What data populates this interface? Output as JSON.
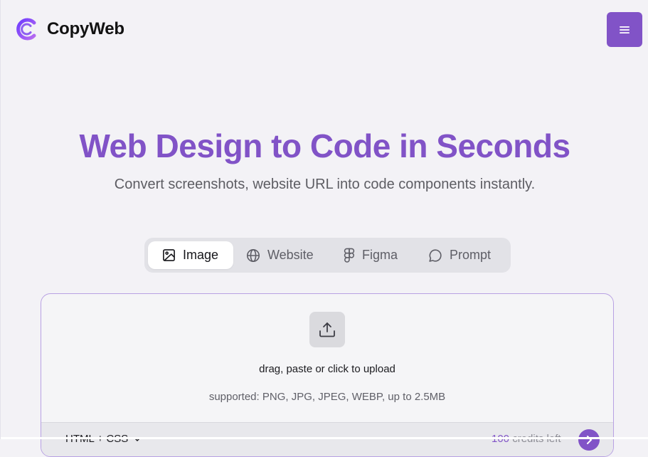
{
  "header": {
    "brand": "CopyWeb",
    "logo_icon": "copyweb-c-logo",
    "menu_icon": "hamburger-menu-icon"
  },
  "hero": {
    "title": "Web Design to Code in Seconds",
    "subtitle": "Convert screenshots, website URL into code components instantly."
  },
  "tabs": [
    {
      "label": "Image",
      "icon": "image-icon",
      "active": true
    },
    {
      "label": "Website",
      "icon": "globe-icon",
      "active": false
    },
    {
      "label": "Figma",
      "icon": "figma-icon",
      "active": false
    },
    {
      "label": "Prompt",
      "icon": "chat-bubble-icon",
      "active": false
    }
  ],
  "upload": {
    "icon": "upload-icon",
    "instruction": "drag, paste or click to upload",
    "supported": "supported: PNG, JPG, JPEG, WEBP, up to 2.5MB"
  },
  "footer": {
    "framework": "HTML + CSS",
    "framework_icon": "chevron-down-icon",
    "credits_count": "100",
    "credits_suffix": " credits left",
    "send_icon": "arrow-right-icon"
  },
  "colors": {
    "accent": "#8153c7",
    "background": "#f3f2f6",
    "text": "#121212"
  }
}
